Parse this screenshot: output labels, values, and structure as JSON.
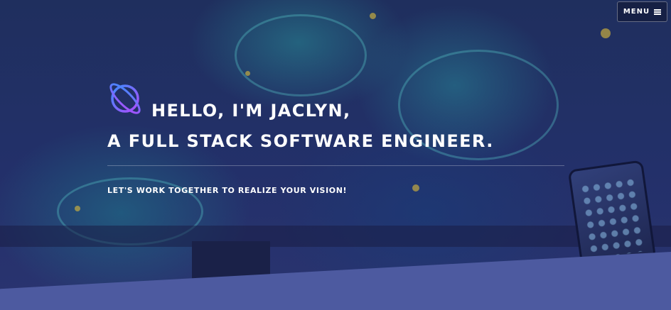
{
  "header": {
    "menu_label": "MENU",
    "menu_icon": "hamburger-icon"
  },
  "hero": {
    "logo_icon": "planet-ring-icon",
    "headline_line1": "HELLO, I'M JACLYN,",
    "headline_line2": "A FULL STACK SOFTWARE ENGINEER.",
    "tagline": "LET'S WORK TOGETHER TO REALIZE YOUR VISION!"
  },
  "colors": {
    "background": "#1c2550",
    "bottom_band": "#4d5aa0",
    "text": "#ffffff",
    "logo_gradient_start": "#3d8cff",
    "logo_gradient_end": "#b04bff"
  }
}
